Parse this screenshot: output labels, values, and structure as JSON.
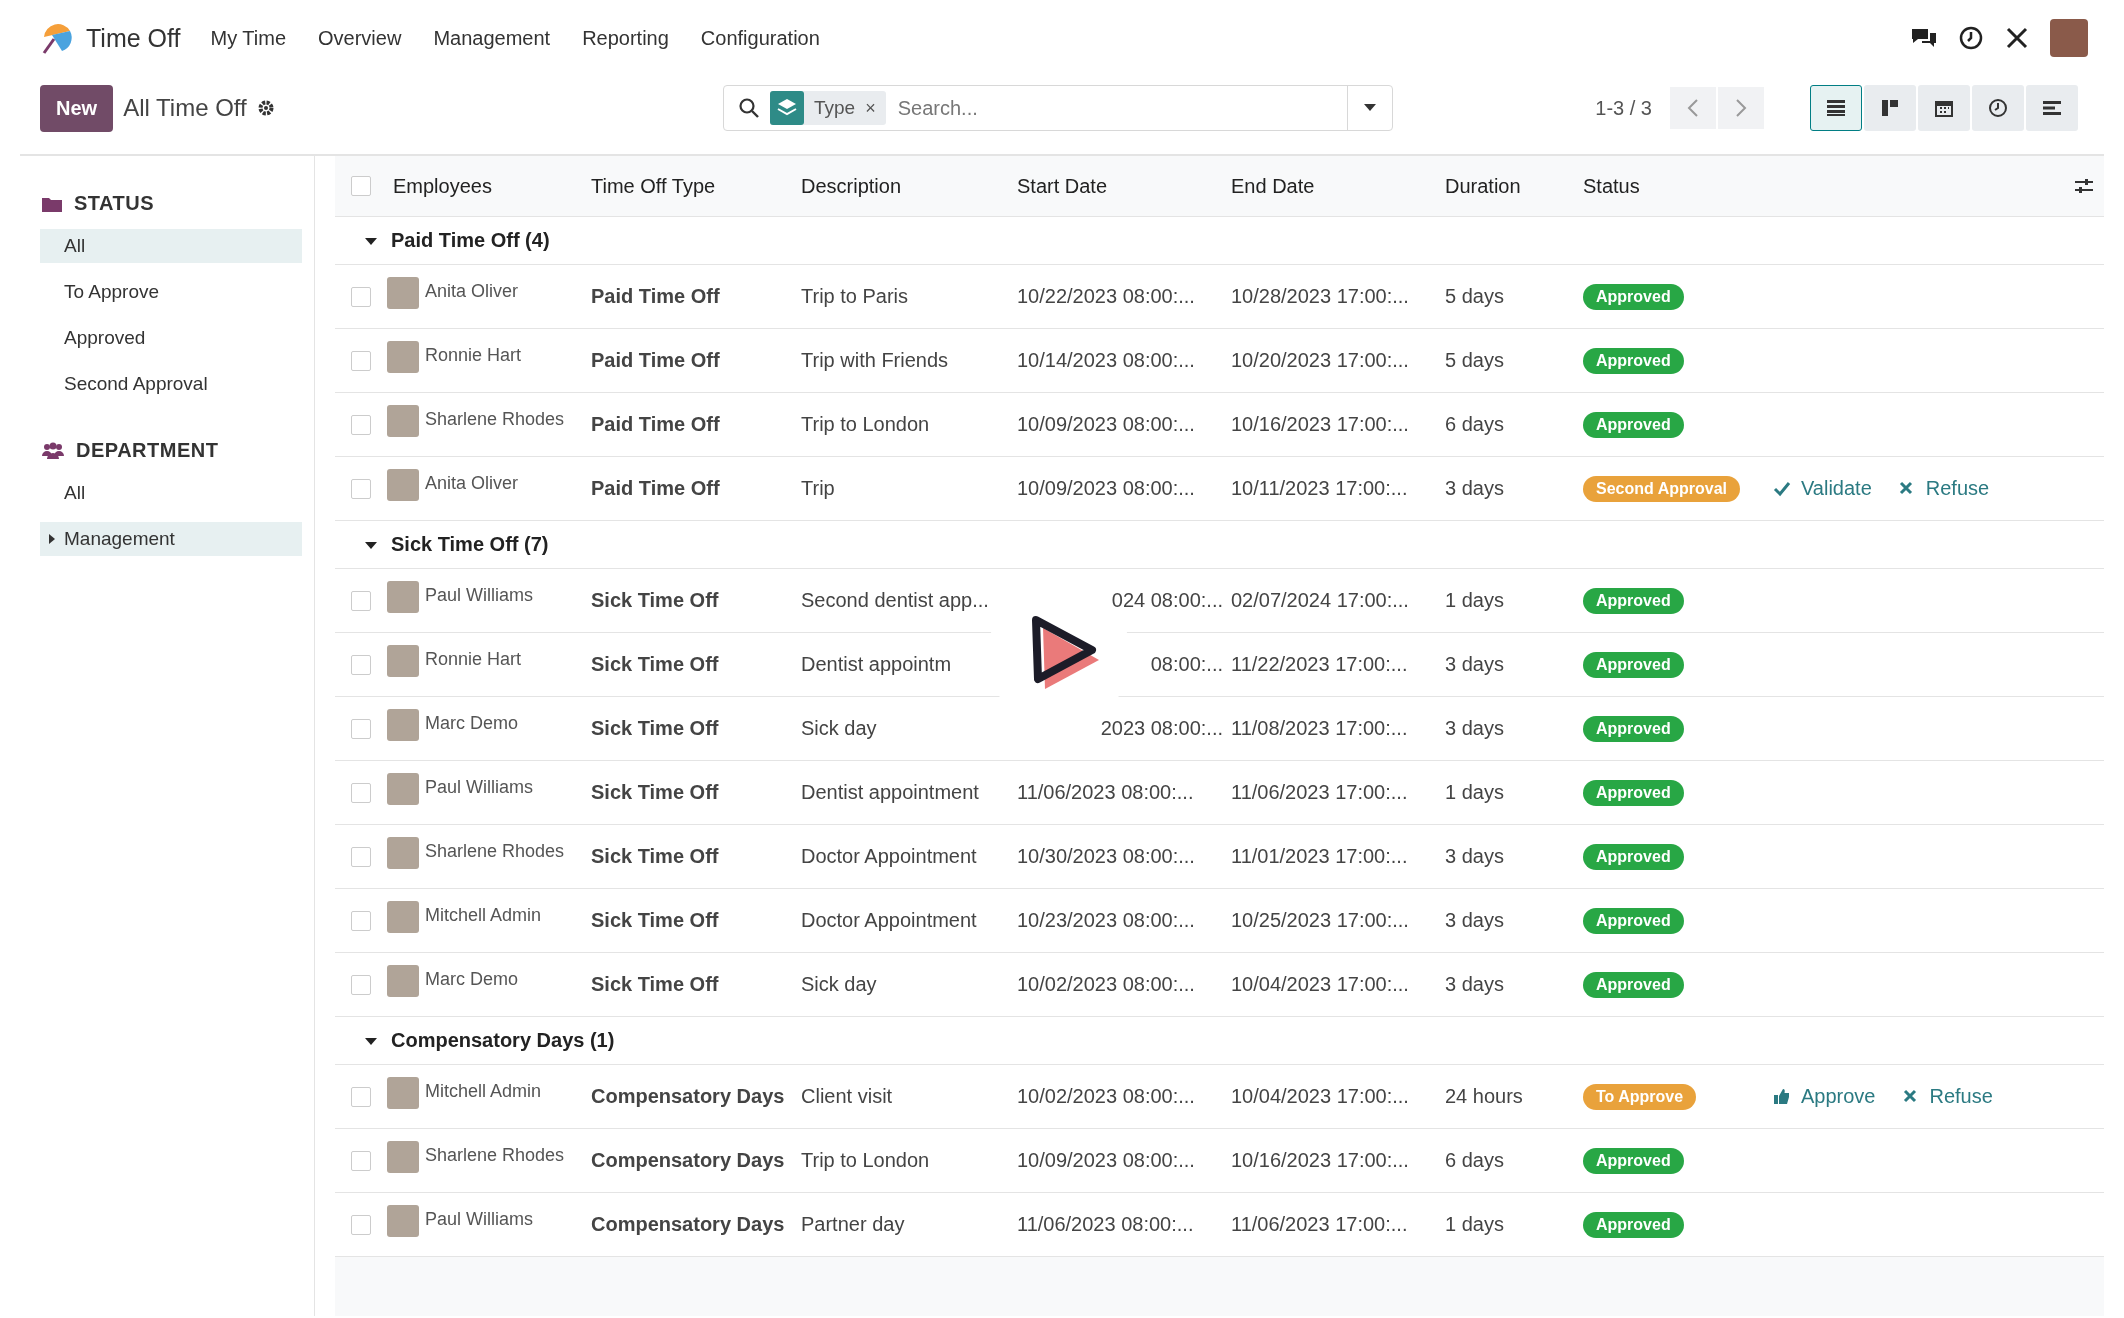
{
  "navbar": {
    "app_name": "Time Off",
    "menu": [
      "My Time",
      "Overview",
      "Management",
      "Reporting",
      "Configuration"
    ]
  },
  "control_panel": {
    "new_button": "New",
    "title": "All Time Off",
    "search": {
      "facet_label": "Type",
      "facet_remove": "×",
      "placeholder": "Search..."
    },
    "pager": "1-3 / 3",
    "views": [
      {
        "kind": "list",
        "selected": true
      },
      {
        "kind": "kanban",
        "selected": false
      },
      {
        "kind": "calendar",
        "selected": false
      },
      {
        "kind": "activity",
        "selected": false
      },
      {
        "kind": "gantt",
        "selected": false
      }
    ]
  },
  "sidebar": {
    "sections": [
      {
        "kind": "status",
        "title": "STATUS",
        "items": [
          {
            "label": "All",
            "selected": true
          },
          {
            "label": "To Approve",
            "selected": false
          },
          {
            "label": "Approved",
            "selected": false
          },
          {
            "label": "Second Approval",
            "selected": false
          }
        ]
      },
      {
        "kind": "department",
        "title": "DEPARTMENT",
        "items": [
          {
            "label": "All",
            "selected": false
          },
          {
            "label": "Management",
            "selected": true,
            "expanded": false
          }
        ]
      }
    ]
  },
  "table": {
    "select_all_checked": false,
    "columns": [
      "Employees",
      "Time Off Type",
      "Description",
      "Start Date",
      "End Date",
      "Duration",
      "Status"
    ],
    "groups": [
      {
        "label": "Paid Time Off (4)",
        "expanded": true,
        "rows": [
          {
            "checked": false,
            "employee": "Anita Oliver",
            "type": "Paid Time Off",
            "description": "Trip to Paris",
            "start": "10/22/2023 08:00:...",
            "end": "10/28/2023 17:00:...",
            "duration": "5 days",
            "status": "Approved",
            "color": "#28a745"
          },
          {
            "checked": false,
            "employee": "Ronnie Hart",
            "type": "Paid Time Off",
            "description": "Trip with Friends",
            "start": "10/14/2023 08:00:...",
            "end": "10/20/2023 17:00:...",
            "duration": "5 days",
            "status": "Approved",
            "color": "#28a745"
          },
          {
            "checked": false,
            "employee": "Sharlene Rhodes",
            "type": "Paid Time Off",
            "description": "Trip to London",
            "start": "10/09/2023 08:00:...",
            "end": "10/16/2023 17:00:...",
            "duration": "6 days",
            "status": "Approved",
            "color": "#28a745"
          },
          {
            "checked": false,
            "employee": "Anita Oliver",
            "type": "Paid Time Off",
            "description": "Trip",
            "start": "10/09/2023 08:00:...",
            "end": "10/11/2023 17:00:...",
            "duration": "3 days",
            "status": "Second Approval",
            "color": "#e9a23b",
            "actions": [
              {
                "kind": "validate",
                "label": "Validate"
              },
              {
                "kind": "refuse",
                "label": "Refuse"
              }
            ]
          }
        ]
      },
      {
        "label": "Sick Time Off (7)",
        "expanded": true,
        "rows": [
          {
            "checked": false,
            "employee": "Paul Williams",
            "type": "Sick Time Off",
            "description": "Second dentist app...",
            "start": "024 08:00:...",
            "end": "02/07/2024 17:00:...",
            "duration": "1 days",
            "status": "Approved",
            "color": "#28a745"
          },
          {
            "checked": false,
            "employee": "Ronnie Hart",
            "type": "Sick Time Off",
            "description": "Dentist appointm",
            "start": "08:00:...",
            "end": "11/22/2023 17:00:...",
            "duration": "3 days",
            "status": "Approved",
            "color": "#28a745"
          },
          {
            "checked": false,
            "employee": "Marc Demo",
            "type": "Sick Time Off",
            "description": "Sick day",
            "start": "2023 08:00:...",
            "end": "11/08/2023 17:00:...",
            "duration": "3 days",
            "status": "Approved",
            "color": "#28a745"
          },
          {
            "checked": false,
            "employee": "Paul Williams",
            "type": "Sick Time Off",
            "description": "Dentist appointment",
            "start": "11/06/2023 08:00:...",
            "end": "11/06/2023 17:00:...",
            "duration": "1 days",
            "status": "Approved",
            "color": "#28a745"
          },
          {
            "checked": false,
            "employee": "Sharlene Rhodes",
            "type": "Sick Time Off",
            "description": "Doctor Appointment",
            "start": "10/30/2023 08:00:...",
            "end": "11/01/2023 17:00:...",
            "duration": "3 days",
            "status": "Approved",
            "color": "#28a745"
          },
          {
            "checked": false,
            "employee": "Mitchell Admin",
            "type": "Sick Time Off",
            "description": "Doctor Appointment",
            "start": "10/23/2023 08:00:...",
            "end": "10/25/2023 17:00:...",
            "duration": "3 days",
            "status": "Approved",
            "color": "#28a745"
          },
          {
            "checked": false,
            "employee": "Marc Demo",
            "type": "Sick Time Off",
            "description": "Sick day",
            "start": "10/02/2023 08:00:...",
            "end": "10/04/2023 17:00:...",
            "duration": "3 days",
            "status": "Approved",
            "color": "#28a745"
          }
        ]
      },
      {
        "label": "Compensatory Days (1)",
        "expanded": true,
        "rows": [
          {
            "checked": false,
            "employee": "Mitchell Admin",
            "type": "Compensatory Days",
            "description": "Client visit",
            "start": "10/02/2023 08:00:...",
            "end": "10/04/2023 17:00:...",
            "duration": "24 hours",
            "status": "To Approve",
            "color": "#e9a23b",
            "actions": [
              {
                "kind": "approve",
                "label": "Approve"
              },
              {
                "kind": "refuse",
                "label": "Refuse"
              }
            ]
          },
          {
            "checked": false,
            "employee": "Sharlene Rhodes",
            "type": "Compensatory Days",
            "description": "Trip to London",
            "start": "10/09/2023 08:00:...",
            "end": "10/16/2023 17:00:...",
            "duration": "6 days",
            "status": "Approved",
            "color": "#28a745"
          },
          {
            "checked": false,
            "employee": "Paul Williams",
            "type": "Compensatory Days",
            "description": "Partner day",
            "start": "11/06/2023 08:00:...",
            "end": "11/06/2023 17:00:...",
            "duration": "1 days",
            "status": "Approved",
            "color": "#28a745"
          }
        ]
      }
    ]
  },
  "video_overlay": {
    "play_button": true
  }
}
